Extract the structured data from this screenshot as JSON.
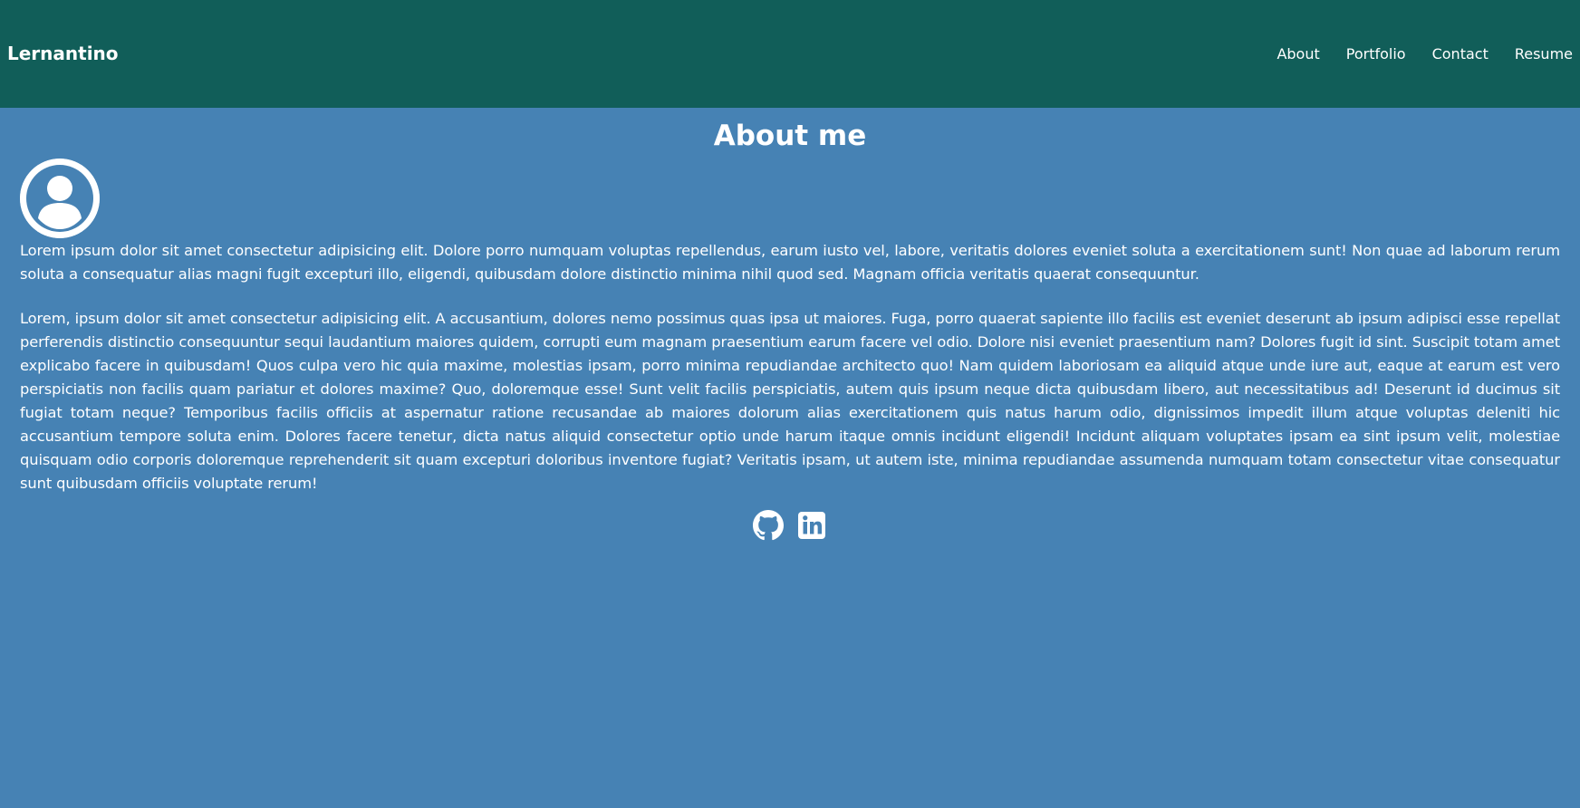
{
  "header": {
    "brand": "Lernantino",
    "nav": [
      {
        "label": "About"
      },
      {
        "label": "Portfolio"
      },
      {
        "label": "Contact"
      },
      {
        "label": "Resume"
      }
    ]
  },
  "about": {
    "title": "About me",
    "avatar_icon": "user-avatar-icon",
    "paragraphs": [
      "Lorem ipsum dolor sit amet consectetur adipisicing elit. Dolore porro numquam voluptas repellendus, earum iusto vel, labore, veritatis dolores eveniet soluta a exercitationem sunt! Non quae ad laborum rerum soluta a consequatur alias magni fugit excepturi illo, eligendi, quibusdam dolore distinctio minima nihil quod sed. Magnam officia veritatis quaerat consequuntur.",
      "Lorem, ipsum dolor sit amet consectetur adipisicing elit. A accusantium, dolores nemo possimus quas ipsa ut maiores. Fuga, porro quaerat sapiente illo facilis est eveniet deserunt ab ipsum adipisci esse repellat perferendis distinctio consequuntur sequi laudantium maiores quidem, corrupti eum magnam praesentium earum facere vel odio. Dolore nisi eveniet praesentium nam? Dolores fugit id sint. Suscipit totam amet explicabo facere in quibusdam! Quos culpa vero hic quia maxime, molestias ipsam, porro minima repudiandae architecto quo! Nam quidem laboriosam ea aliquid atque unde iure aut, eaque at earum est vero perspiciatis non facilis quam pariatur et dolores maxime? Quo, doloremque esse! Sunt velit facilis perspiciatis, autem quis ipsum neque dicta quibusdam libero, aut necessitatibus ad! Deserunt id ducimus sit fugiat totam neque? Temporibus facilis officiis at aspernatur ratione recusandae ab maiores dolorum alias exercitationem quis natus harum odio, dignissimos impedit illum atque voluptas deleniti hic accusantium tempore soluta enim. Dolores facere tenetur, dicta natus aliquid consectetur optio unde harum itaque omnis incidunt eligendi! Incidunt aliquam voluptates ipsam ea sint ipsum velit, molestiae quisquam odio corporis doloremque reprehenderit sit quam excepturi doloribus inventore fugiat? Veritatis ipsam, ut autem iste, minima repudiandae assumenda numquam totam consectetur vitae consequatur sunt quibusdam officiis voluptate rerum!"
    ]
  },
  "social": [
    {
      "icon": "github-icon"
    },
    {
      "icon": "linkedin-icon"
    }
  ],
  "colors": {
    "header_bg": "#115e59",
    "page_bg": "#4682b4",
    "text": "#ffffff"
  }
}
